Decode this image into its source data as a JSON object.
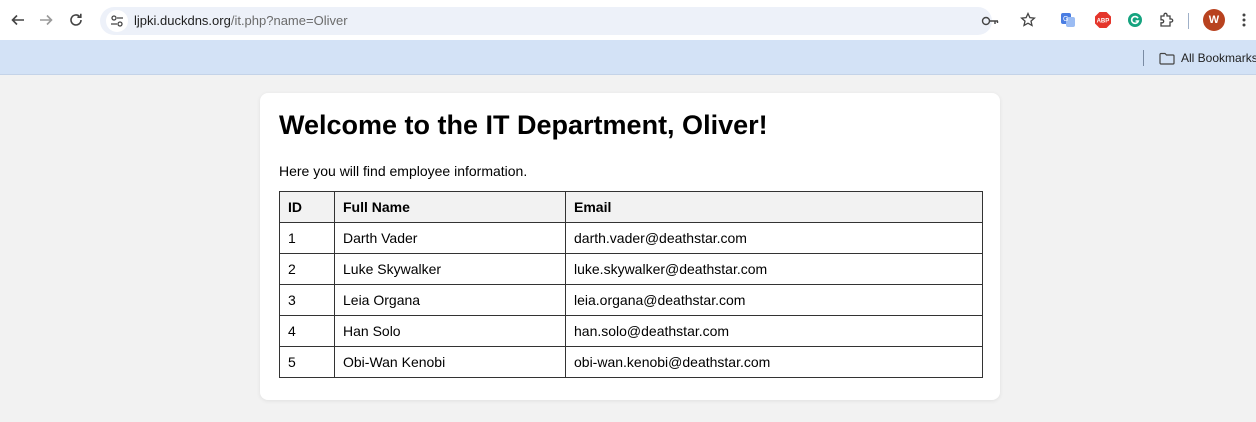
{
  "browser": {
    "url_host": "ljpki.duckdns.org",
    "url_path": "/it.php?name=Oliver",
    "profile_initial": "W",
    "bookmark_folder": "All Bookmarks"
  },
  "page": {
    "title": "Welcome to the IT Department, Oliver!",
    "intro": "Here you will find employee information.",
    "table": {
      "headers": [
        "ID",
        "Full Name",
        "Email"
      ],
      "rows": [
        {
          "id": "1",
          "name": "Darth Vader",
          "email": "darth.vader@deathstar.com"
        },
        {
          "id": "2",
          "name": "Luke Skywalker",
          "email": "luke.skywalker@deathstar.com"
        },
        {
          "id": "3",
          "name": "Leia Organa",
          "email": "leia.organa@deathstar.com"
        },
        {
          "id": "4",
          "name": "Han Solo",
          "email": "han.solo@deathstar.com"
        },
        {
          "id": "5",
          "name": "Obi-Wan Kenobi",
          "email": "obi-wan.kenobi@deathstar.com"
        }
      ]
    }
  },
  "icons": {
    "back": "arrow-left-icon",
    "forward": "arrow-right-icon",
    "reload": "reload-icon",
    "site_info": "tune-icon",
    "password_key": "key-icon",
    "bookmark_star": "star-icon",
    "translate": "translate-extension-icon",
    "adblock": "abp-extension-icon",
    "grammarly": "grammarly-extension-icon",
    "extensions": "puzzle-icon",
    "menu": "kebab-menu-icon",
    "folder": "folder-icon"
  },
  "colors": {
    "toolbar_bg": "#ffffff",
    "omnibox_bg": "#edf1f9",
    "bookmarks_bg": "#d3e2f6",
    "page_bg": "#f2f2f2",
    "abp_red": "#e5352b",
    "grammarly_green": "#15a37f",
    "translate_blue": "#4a7de2",
    "avatar": "#b8421f"
  }
}
